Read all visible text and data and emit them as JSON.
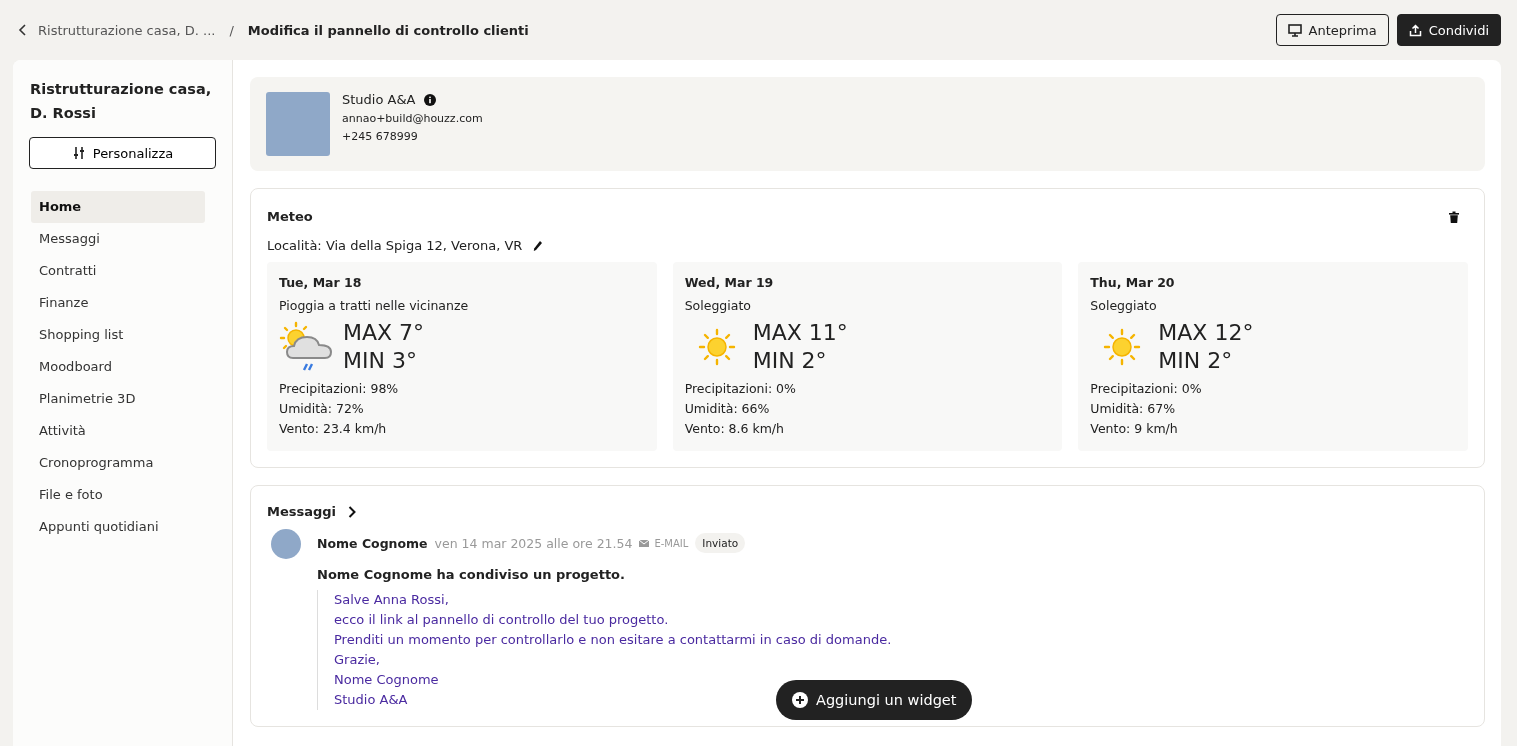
{
  "breadcrumb": {
    "parent": "Ristrutturazione casa, D. ...",
    "separator": "/",
    "current": "Modifica il pannello di controllo clienti"
  },
  "header_buttons": [
    {
      "label": "Anteprima",
      "kind": "outline"
    },
    {
      "label": "Condividi",
      "kind": "primary"
    }
  ],
  "sidebar": {
    "title": "Ristrutturazione casa, D. Rossi",
    "customize_button": "Personalizza",
    "items": [
      {
        "label": "Home",
        "selected": true
      },
      {
        "label": "Messaggi",
        "selected": false
      },
      {
        "label": "Contratti",
        "selected": false
      },
      {
        "label": "Finanze",
        "selected": false
      },
      {
        "label": "Shopping list",
        "selected": false
      },
      {
        "label": "Moodboard",
        "selected": false
      },
      {
        "label": "Planimetrie 3D",
        "selected": false
      },
      {
        "label": "Attività",
        "selected": false
      },
      {
        "label": "Cronoprogramma",
        "selected": false
      },
      {
        "label": "File e foto",
        "selected": false
      },
      {
        "label": "Appunti quotidiani",
        "selected": false
      }
    ]
  },
  "company": {
    "name": "Studio A&A",
    "email": "annao+build@houzz.com",
    "phone": "+245 678999"
  },
  "weather": {
    "title": "Meteo",
    "location": "Località: Via della Spiga 12, Verona, VR",
    "days": [
      {
        "date": "Tue, Mar 18",
        "condition": "Pioggia a tratti nelle vicinanze",
        "kind": "rain",
        "max": "MAX 7°",
        "min": "MIN 3°",
        "precipitation": "Precipitazioni: 98%",
        "humidity": "Umidità: 72%",
        "wind": "Vento: 23.4 km/h"
      },
      {
        "date": "Wed, Mar 19",
        "condition": "Soleggiato",
        "kind": "sunny",
        "max": "MAX 11°",
        "min": "MIN 2°",
        "precipitation": "Precipitazioni: 0%",
        "humidity": "Umidità: 66%",
        "wind": "Vento: 8.6 km/h"
      },
      {
        "date": "Thu, Mar 20",
        "condition": "Soleggiato",
        "kind": "sunny",
        "max": "MAX 12°",
        "min": "MIN 2°",
        "precipitation": "Precipitazioni: 0%",
        "humidity": "Umidità: 67%",
        "wind": "Vento: 9 km/h"
      }
    ]
  },
  "messages": {
    "title": "Messaggi",
    "items": [
      {
        "sender": "Nome Cognome",
        "date": "ven 14 mar 2025 alle ore 21.54",
        "channel": "E-MAIL",
        "status": "Inviato",
        "subject": "Nome Cognome ha condiviso un progetto.",
        "body": [
          "Salve Anna Rossi,",
          "ecco il link al pannello di controllo del tuo progetto.",
          "Prenditi un momento per controllarlo e non esitare a contattarmi in caso di domande.",
          "Grazie,",
          "Nome Cognome",
          "Studio A&A"
        ]
      }
    ]
  },
  "add_widget_button": "Aggiungi un widget"
}
